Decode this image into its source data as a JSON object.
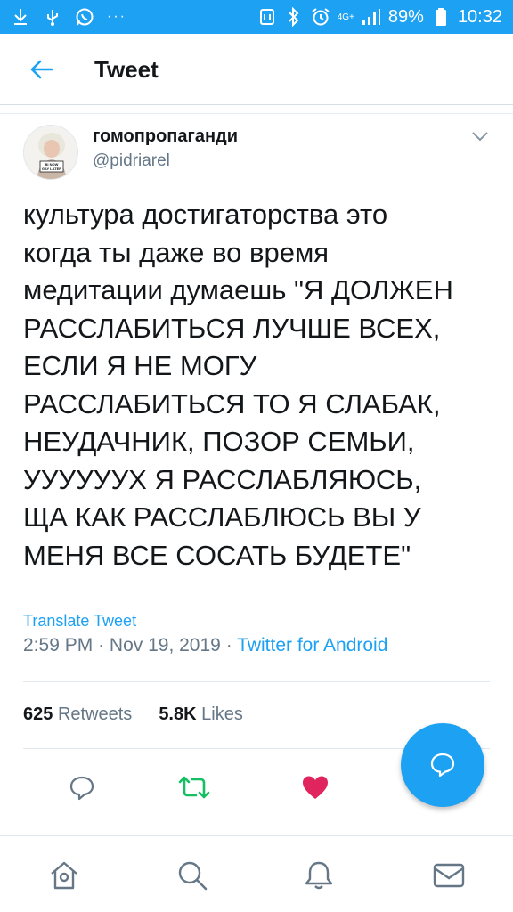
{
  "status_bar": {
    "battery_percent": "89%",
    "time": "10:32",
    "network": "4G+",
    "dots": "···"
  },
  "header": {
    "title": "Tweet"
  },
  "tweet": {
    "display_name": "гомопропаганди",
    "handle": "@pidriarel",
    "avatar_caption": "BI NOW GAY LATER",
    "text": "культура достигаторства это\nкогда ты даже во время\nмедитации думаешь \"Я ДОЛЖЕН\nРАССЛАБИТЬСЯ ЛУЧШЕ ВСЕХ,\nЕСЛИ Я НЕ МОГУ\nРАССЛАБИТЬСЯ ТО Я СЛАБАК,\nНЕУДАЧНИК, ПОЗОР СЕМЬИ,\nУУУУУУХ Я РАССЛАБЛЯЮСЬ,\nЩА КАК РАССЛАБЛЮСЬ ВЫ У\nМЕНЯ ВСЕ СОСАТЬ БУДЕТЕ\"",
    "translate_label": "Translate Tweet",
    "time": "2:59 PM",
    "separator": "·",
    "date": "Nov 19, 2019",
    "source": "Twitter for Android",
    "retweets_count": "625",
    "retweets_label": "Retweets",
    "likes_count": "5.8K",
    "likes_label": "Likes"
  },
  "colors": {
    "accent": "#1da1f2",
    "retweet_green": "#17bf63",
    "like_red": "#e0245e",
    "secondary_text": "#657786"
  },
  "icons": {
    "status_left": [
      "download-icon",
      "usb-icon",
      "whatsapp-icon"
    ],
    "status_right": [
      "nfc-icon",
      "bluetooth-icon",
      "alarm-icon",
      "signal-icon",
      "battery-icon"
    ],
    "actions": [
      "reply-icon",
      "retweet-icon",
      "like-icon"
    ],
    "fab": "compose-reply-icon",
    "nav": [
      "home-icon",
      "search-icon",
      "notifications-icon",
      "messages-icon"
    ]
  }
}
